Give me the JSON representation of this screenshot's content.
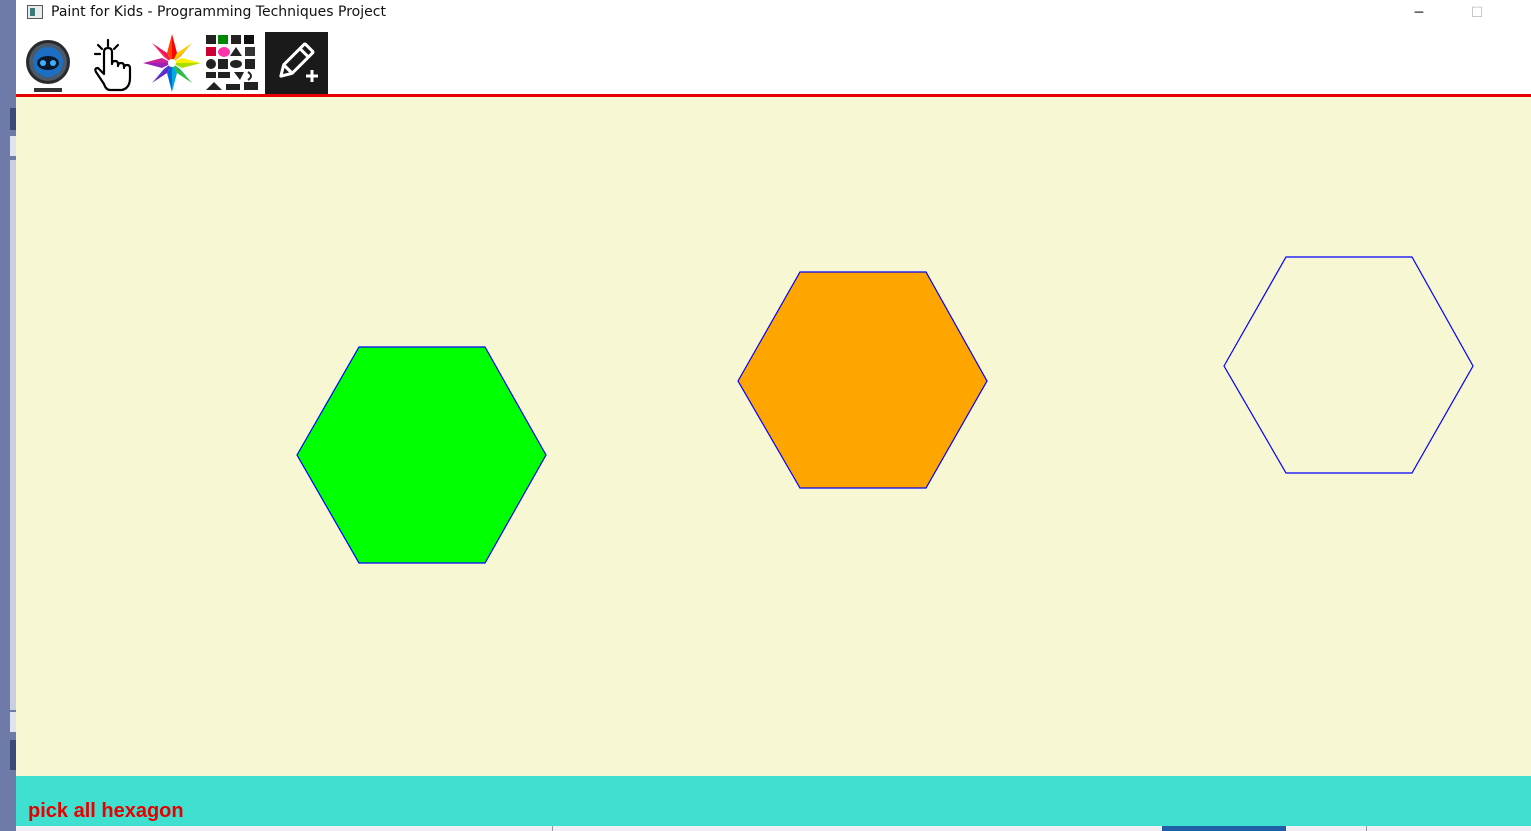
{
  "window": {
    "title": "Paint for Kids - Programming Techniques Project",
    "minimize_glyph": "─",
    "maximize_glyph": "☐"
  },
  "toolbar": {
    "items": [
      {
        "name": "exit-robot",
        "icon": "robot-icon"
      },
      {
        "name": "select",
        "icon": "pointer-hand-icon"
      },
      {
        "name": "colors",
        "icon": "color-wheel-icon"
      },
      {
        "name": "shapes",
        "icon": "shapes-palette-icon"
      },
      {
        "name": "draw-mode",
        "icon": "pencil-plus-icon"
      }
    ],
    "separator_color": "#e60000"
  },
  "canvas": {
    "background": "#f8f7d3",
    "shapes": [
      {
        "type": "hexagon",
        "fill": "#00ff00",
        "border": "#0000ff",
        "filled": true
      },
      {
        "type": "hexagon",
        "fill": "#ffa500",
        "border": "#0000ff",
        "filled": true
      },
      {
        "type": "hexagon",
        "fill": "none",
        "border": "#0000ff",
        "filled": false
      }
    ]
  },
  "status": {
    "message": "pick all hexagon",
    "background": "#40e0d0",
    "text_color": "#e60000"
  }
}
